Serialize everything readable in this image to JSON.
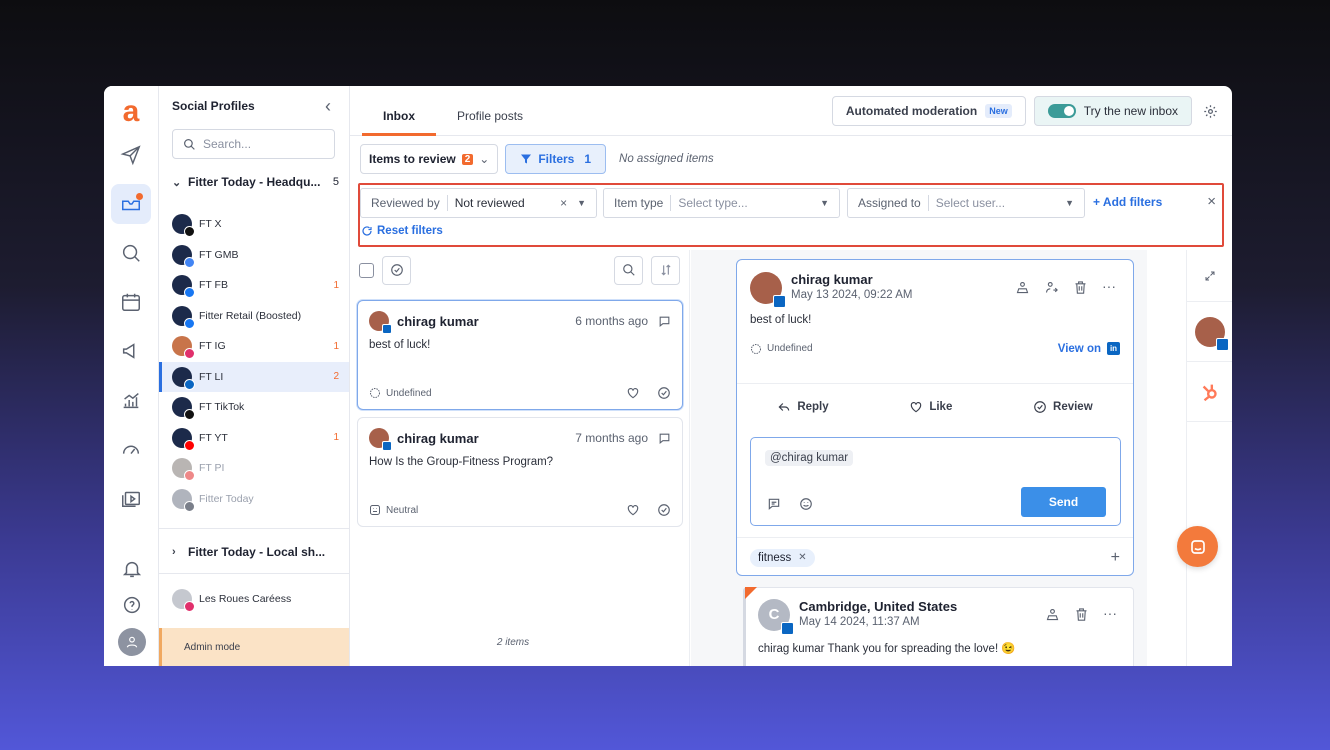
{
  "sidebar": {
    "title": "Social Profiles",
    "search_placeholder": "Search...",
    "groups": [
      {
        "label": "Fitter Today - Headqu...",
        "count": "5"
      },
      {
        "label": "Fitter Today - Local sh..."
      }
    ],
    "profiles": [
      {
        "name": "FT X",
        "count": ""
      },
      {
        "name": "FT GMB",
        "count": ""
      },
      {
        "name": "FT FB",
        "count": "1"
      },
      {
        "name": "Fitter Retail (Boosted)",
        "count": ""
      },
      {
        "name": "FT IG",
        "count": "1"
      },
      {
        "name": "FT LI",
        "count": "2"
      },
      {
        "name": "FT TikTok",
        "count": ""
      },
      {
        "name": "FT YT",
        "count": "1"
      },
      {
        "name": "FT PI",
        "count": ""
      },
      {
        "name": "Fitter Today",
        "count": ""
      }
    ],
    "other_profile": "Les Roues Caréess",
    "admin_mode": "Admin mode"
  },
  "tabs": [
    {
      "label": "Inbox"
    },
    {
      "label": "Profile posts"
    }
  ],
  "toolbar": {
    "automated_moderation": "Automated moderation",
    "new_badge": "New",
    "try_new_inbox": "Try the new inbox",
    "items_to_review": "Items to review",
    "items_to_review_count": "2",
    "filters_label": "Filters",
    "filters_count": "1",
    "no_assigned": "No assigned items"
  },
  "filters": {
    "reviewed_by_label": "Reviewed by",
    "reviewed_by_value": "Not reviewed",
    "item_type_label": "Item type",
    "item_type_placeholder": "Select type...",
    "assigned_to_label": "Assigned to",
    "assigned_to_placeholder": "Select user...",
    "add_filters": "Add filters",
    "reset_filters": "Reset filters"
  },
  "list": {
    "items": [
      {
        "author": "chirag kumar",
        "ago": "6 months ago",
        "text": "best of luck!",
        "sentiment": "Undefined"
      },
      {
        "author": "chirag kumar",
        "ago": "7 months ago",
        "text": "How Is the Group-Fitness Program?",
        "sentiment": "Neutral"
      }
    ],
    "count": "2 items"
  },
  "detail": {
    "author": "chirag kumar",
    "date": "May 13 2024, 09:22 AM",
    "text": "best of luck!",
    "sentiment": "Undefined",
    "view_on": "View on",
    "actions": {
      "reply": "Reply",
      "like": "Like",
      "review": "Review"
    },
    "mention": "@chirag kumar",
    "send": "Send",
    "tag": "fitness",
    "comment": {
      "initial": "C",
      "author": "Cambridge, United States",
      "date": "May 14 2024, 11:37 AM",
      "text": "chirag kumar  Thank you for spreading the love! 😉"
    }
  },
  "colors": {
    "accent": "#f26a2e",
    "primary": "#2a6fe0",
    "highlight_border": "#e04a3a"
  }
}
